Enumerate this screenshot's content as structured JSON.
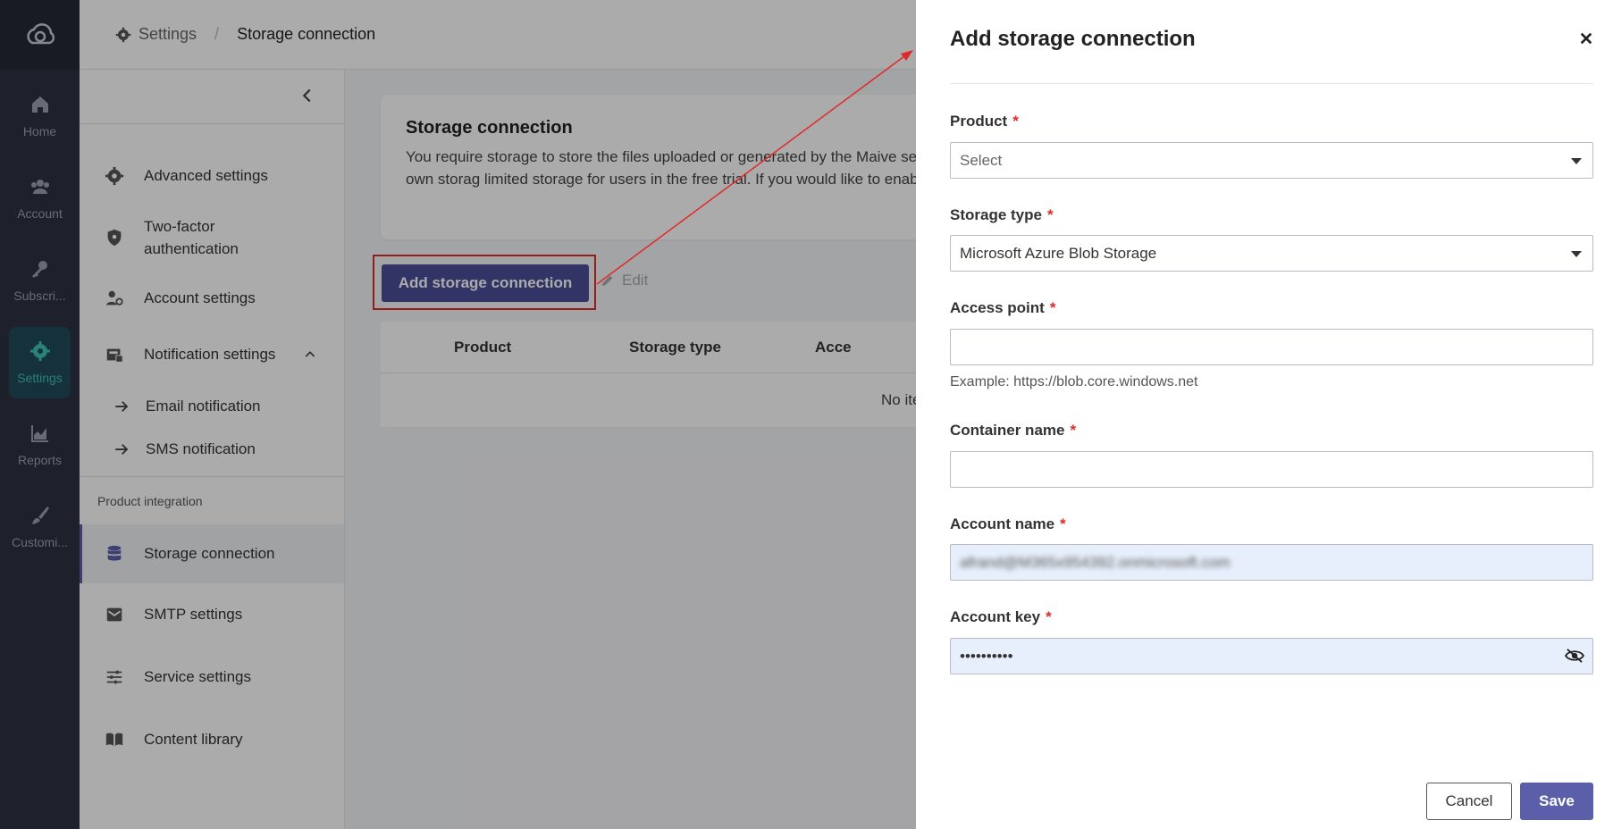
{
  "rail": {
    "items": [
      {
        "label": "Home",
        "icon": "home-icon"
      },
      {
        "label": "Account",
        "icon": "users-icon"
      },
      {
        "label": "Subscri...",
        "icon": "key-icon"
      },
      {
        "label": "Settings",
        "icon": "gear-icon",
        "active": true
      },
      {
        "label": "Reports",
        "icon": "chart-icon"
      },
      {
        "label": "Customi...",
        "icon": "brush-icon"
      }
    ]
  },
  "breadcrumb": {
    "parent": "Settings",
    "current": "Storage connection"
  },
  "sidemenu": {
    "items": [
      {
        "label": "Advanced settings",
        "icon": "gear-icon"
      },
      {
        "label": "Two-factor authentication",
        "icon": "shield-icon"
      },
      {
        "label": "Account settings",
        "icon": "user-gear-icon"
      },
      {
        "label": "Notification settings",
        "icon": "inbox-icon"
      }
    ],
    "sub_items": [
      {
        "label": "Email notification"
      },
      {
        "label": "SMS notification"
      }
    ],
    "section_label": "Product integration",
    "integration_items": [
      {
        "label": "Storage connection",
        "icon": "database-icon",
        "active": true
      },
      {
        "label": "SMTP settings",
        "icon": "mail-icon"
      },
      {
        "label": "Service settings",
        "icon": "sliders-icon"
      },
      {
        "label": "Content library",
        "icon": "book-icon"
      }
    ]
  },
  "info": {
    "title": "Storage connection",
    "text": "You require storage to store the files uploaded or generated by the Maive separate storage connections for your products and use your own storag limited storage for users in the free trial. If you would like to enable more"
  },
  "toolbar": {
    "add_label": "Add storage connection",
    "edit_label": "Edit"
  },
  "table": {
    "columns": [
      "Product",
      "Storage type",
      "Acce"
    ],
    "empty": "No ite"
  },
  "drawer": {
    "title": "Add storage connection",
    "product_label": "Product",
    "product_placeholder": "Select",
    "storage_type_label": "Storage type",
    "storage_type_value": "Microsoft Azure Blob Storage",
    "access_point_label": "Access point",
    "access_point_value": "",
    "access_point_hint": "Example: https://blob.core.windows.net",
    "container_label": "Container name",
    "container_value": "",
    "account_name_label": "Account name",
    "account_name_value": "afrand@M365x954392.onmicrosoft.com",
    "account_key_label": "Account key",
    "account_key_value": "••••••••••",
    "required_mark": "*",
    "cancel_label": "Cancel",
    "save_label": "Save"
  },
  "colors": {
    "accent": "#4a4e96",
    "active_rail": "#3fc1b2",
    "annotation": "#e02a2a"
  }
}
